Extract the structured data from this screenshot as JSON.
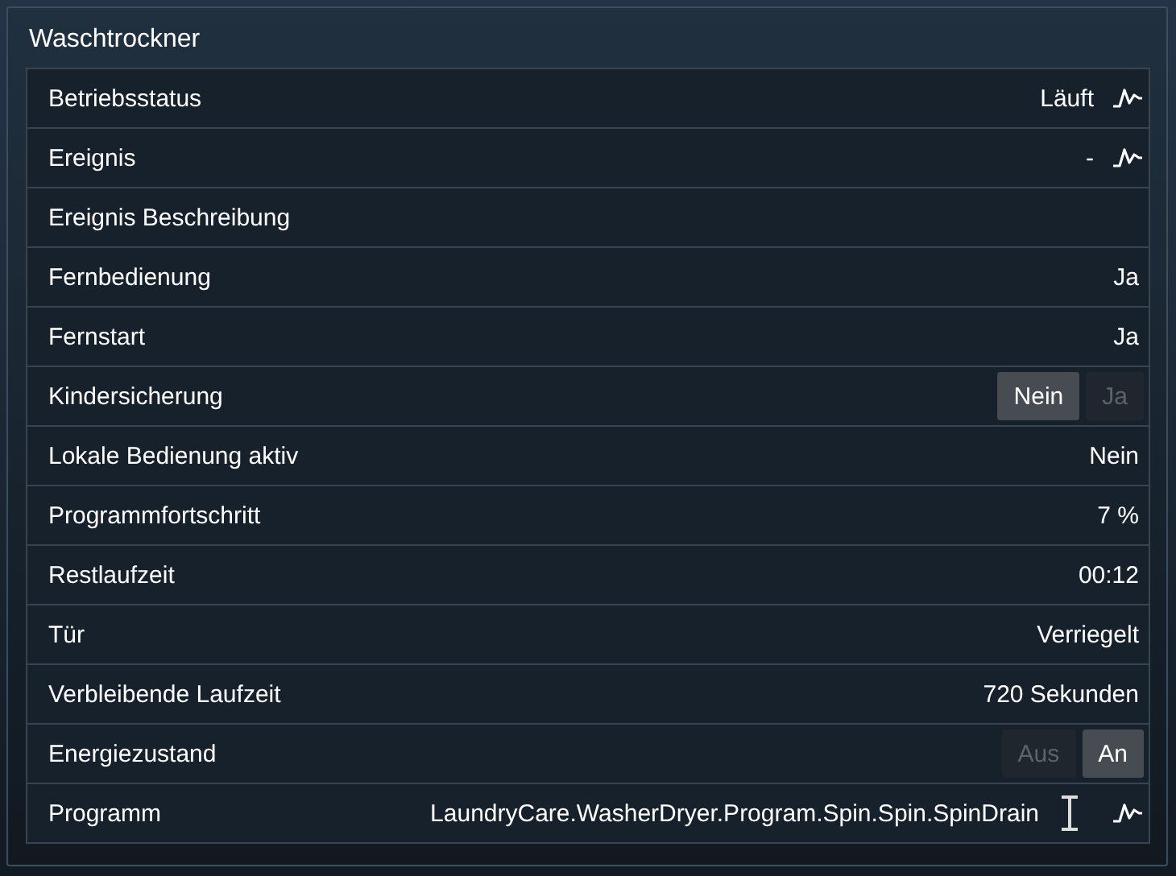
{
  "card": {
    "title": "Waschtrockner"
  },
  "rows": [
    {
      "kind": "text",
      "label": "Betriebsstatus",
      "value": "Läuft",
      "history": true
    },
    {
      "kind": "text",
      "label": "Ereignis",
      "value": "-",
      "history": true
    },
    {
      "kind": "text",
      "label": "Ereignis Beschreibung"
    },
    {
      "kind": "text",
      "label": "Fernbedienung",
      "value": "Ja"
    },
    {
      "kind": "text",
      "label": "Fernstart",
      "value": "Ja"
    },
    {
      "kind": "toggle",
      "label": "Kindersicherung",
      "options": [
        {
          "label": "Nein",
          "selected": true
        },
        {
          "label": "Ja",
          "selected": false
        }
      ]
    },
    {
      "kind": "text",
      "label": "Lokale Bedienung aktiv",
      "value": "Nein"
    },
    {
      "kind": "text",
      "label": "Programmfortschritt",
      "value": "7 %"
    },
    {
      "kind": "text",
      "label": "Restlaufzeit",
      "value": "00:12"
    },
    {
      "kind": "text",
      "label": "Tür",
      "value": "Verriegelt"
    },
    {
      "kind": "text",
      "label": "Verbleibende Laufzeit",
      "value": "720 Sekunden"
    },
    {
      "kind": "toggle",
      "label": "Energiezustand",
      "options": [
        {
          "label": "Aus",
          "selected": false
        },
        {
          "label": "An",
          "selected": true
        }
      ]
    },
    {
      "kind": "text",
      "label": "Programm",
      "value": "LaundryCare.WasherDryer.Program.Spin.Spin.SpinDrain",
      "editable": true,
      "history": true
    }
  ]
}
